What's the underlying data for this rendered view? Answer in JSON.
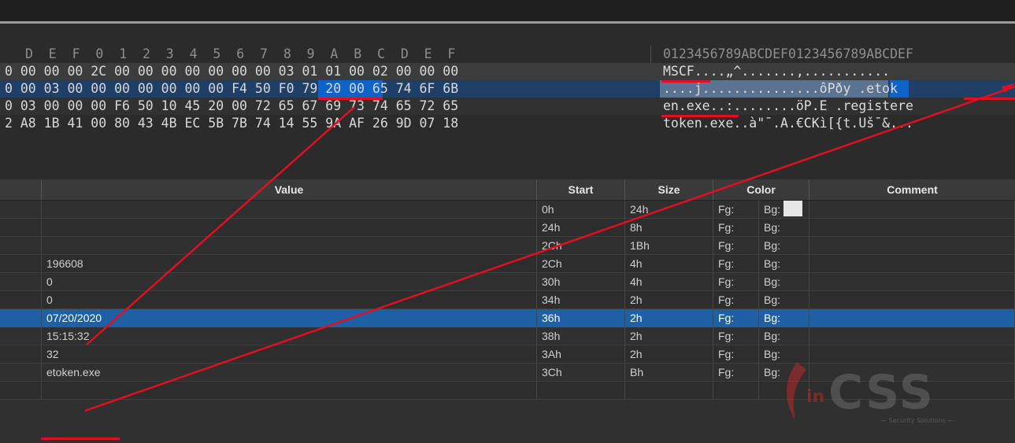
{
  "hex_view": {
    "header_offsets": "D  E  F  0  1  2  3  4  5  6  7  8  9  A  B  C  D  E  F",
    "header_ascii": "0123456789ABCDEF0123456789ABCDEF",
    "rows": [
      {
        "hex": "0 00 00 00 2C 00 00 00 00 00 00 00 03 01 01 00 02 00 00 00",
        "ascii": "MSCF....„^.......,..........."
      },
      {
        "hex": "0 00 03 00 00 00 00 00 00 00 F4 50 F0 79 20 00 65 74 6F 6B",
        "ascii": "....j...............ôPðy .etok"
      },
      {
        "hex": "0 03 00 00 00 F6 50 10 45 20 00 72 65 67 69 73 74 65 72 65",
        "ascii": "en.exe..:........öP.E .registere"
      },
      {
        "hex": "2 A8 1B 41 00 80 43 4B EC 5B 7B 74 14 55 9A AF 26 9D 07 18",
        "ascii": "token.exe..à\"¯.A.€CKì[{t.Uš¯&..."
      }
    ]
  },
  "grid": {
    "columns": {
      "value": "Value",
      "start": "Start",
      "size": "Size",
      "color": "Color",
      "comment": "Comment"
    },
    "fg_label": "Fg:",
    "bg_label": "Bg:",
    "rows": [
      {
        "value": "",
        "start": "0h",
        "size": "24h",
        "bg_swatch": true
      },
      {
        "value": "",
        "start": "24h",
        "size": "8h"
      },
      {
        "value": "",
        "start": "2Ch",
        "size": "1Bh"
      },
      {
        "value": "196608",
        "start": "2Ch",
        "size": "4h"
      },
      {
        "value": "0",
        "start": "30h",
        "size": "4h"
      },
      {
        "value": "0",
        "start": "34h",
        "size": "2h"
      },
      {
        "value": "07/20/2020",
        "start": "36h",
        "size": "2h",
        "selected": true
      },
      {
        "value": "15:15:32",
        "start": "38h",
        "size": "2h"
      },
      {
        "value": "32",
        "start": "3Ah",
        "size": "2h"
      },
      {
        "value": "etoken.exe",
        "start": "3Ch",
        "size": "Bh"
      }
    ]
  },
  "watermark": {
    "text": "CSS",
    "prefix": "in",
    "tagline": "— Security Solutions —"
  },
  "colors": {
    "selected_row": "#1f5fa3",
    "hex_selection": "#0f62c8",
    "annotation_red": "#e01020"
  }
}
